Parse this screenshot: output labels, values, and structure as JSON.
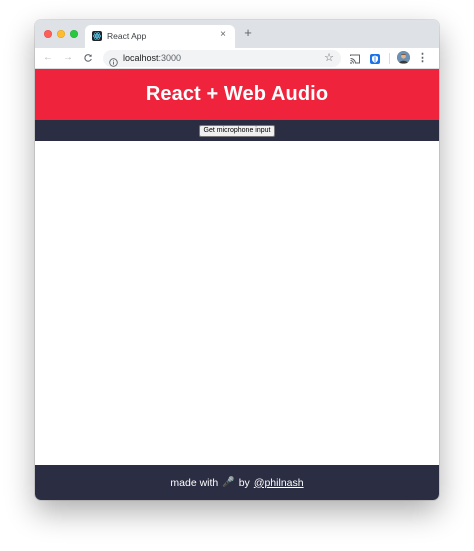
{
  "browser": {
    "tab": {
      "title": "React App",
      "close_glyph": "×"
    },
    "new_tab_glyph": "+",
    "nav": {
      "back_glyph": "←",
      "forward_glyph": "→",
      "reload_glyph": "C"
    },
    "address": {
      "host": "localhost",
      "port": ":3000"
    },
    "star_glyph": "☆",
    "menu_glyph": "⋮",
    "icons": [
      "react-favicon-icon",
      "info-icon",
      "star-icon",
      "cast-icon",
      "password-manager-icon",
      "profile-avatar",
      "menu-icon"
    ]
  },
  "app": {
    "title": "React + Web Audio",
    "mic_button_label": "Get microphone input",
    "footer": {
      "made_with": "made with",
      "mic_emoji": "🎤",
      "by": "by",
      "author_link": "@philnash"
    }
  },
  "colors": {
    "header_red": "#ef233c",
    "navy": "#2b2d42",
    "tabstrip": "#dee1e6"
  }
}
